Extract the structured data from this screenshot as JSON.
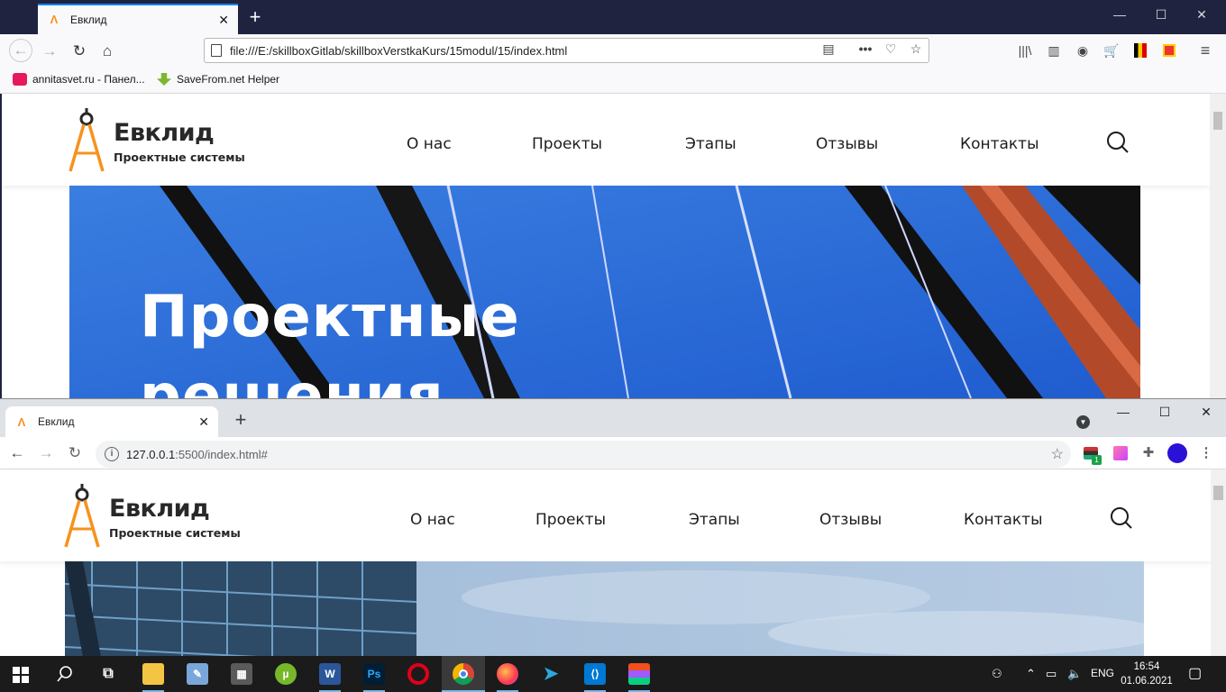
{
  "firefox": {
    "tab_title": "Евклид",
    "url": "file:///E:/skillboxGitlab/skillboxVerstkaKurs/15modul/15/index.html",
    "bookmarks": [
      {
        "label": "annitasvet.ru - Панел..."
      },
      {
        "label": "SaveFrom.net Helper"
      }
    ]
  },
  "chrome": {
    "tab_title": "Евклид",
    "url_host": "127.0.0.1",
    "url_rest": ":5500/index.html#"
  },
  "site": {
    "logo_name": "Евклид",
    "logo_sub": "Проектные системы",
    "nav": [
      "О нас",
      "Проекты",
      "Этапы",
      "Отзывы",
      "Контакты"
    ],
    "hero_title_line1": "Проектные",
    "hero_title_line2": "решения"
  },
  "taskbar": {
    "language": "ENG",
    "time": "16:54",
    "date": "01.06.2021"
  },
  "colors": {
    "accent_orange": "#f7921e",
    "firefox_dark": "#202340",
    "hero_blue": "#2f6fd6"
  }
}
